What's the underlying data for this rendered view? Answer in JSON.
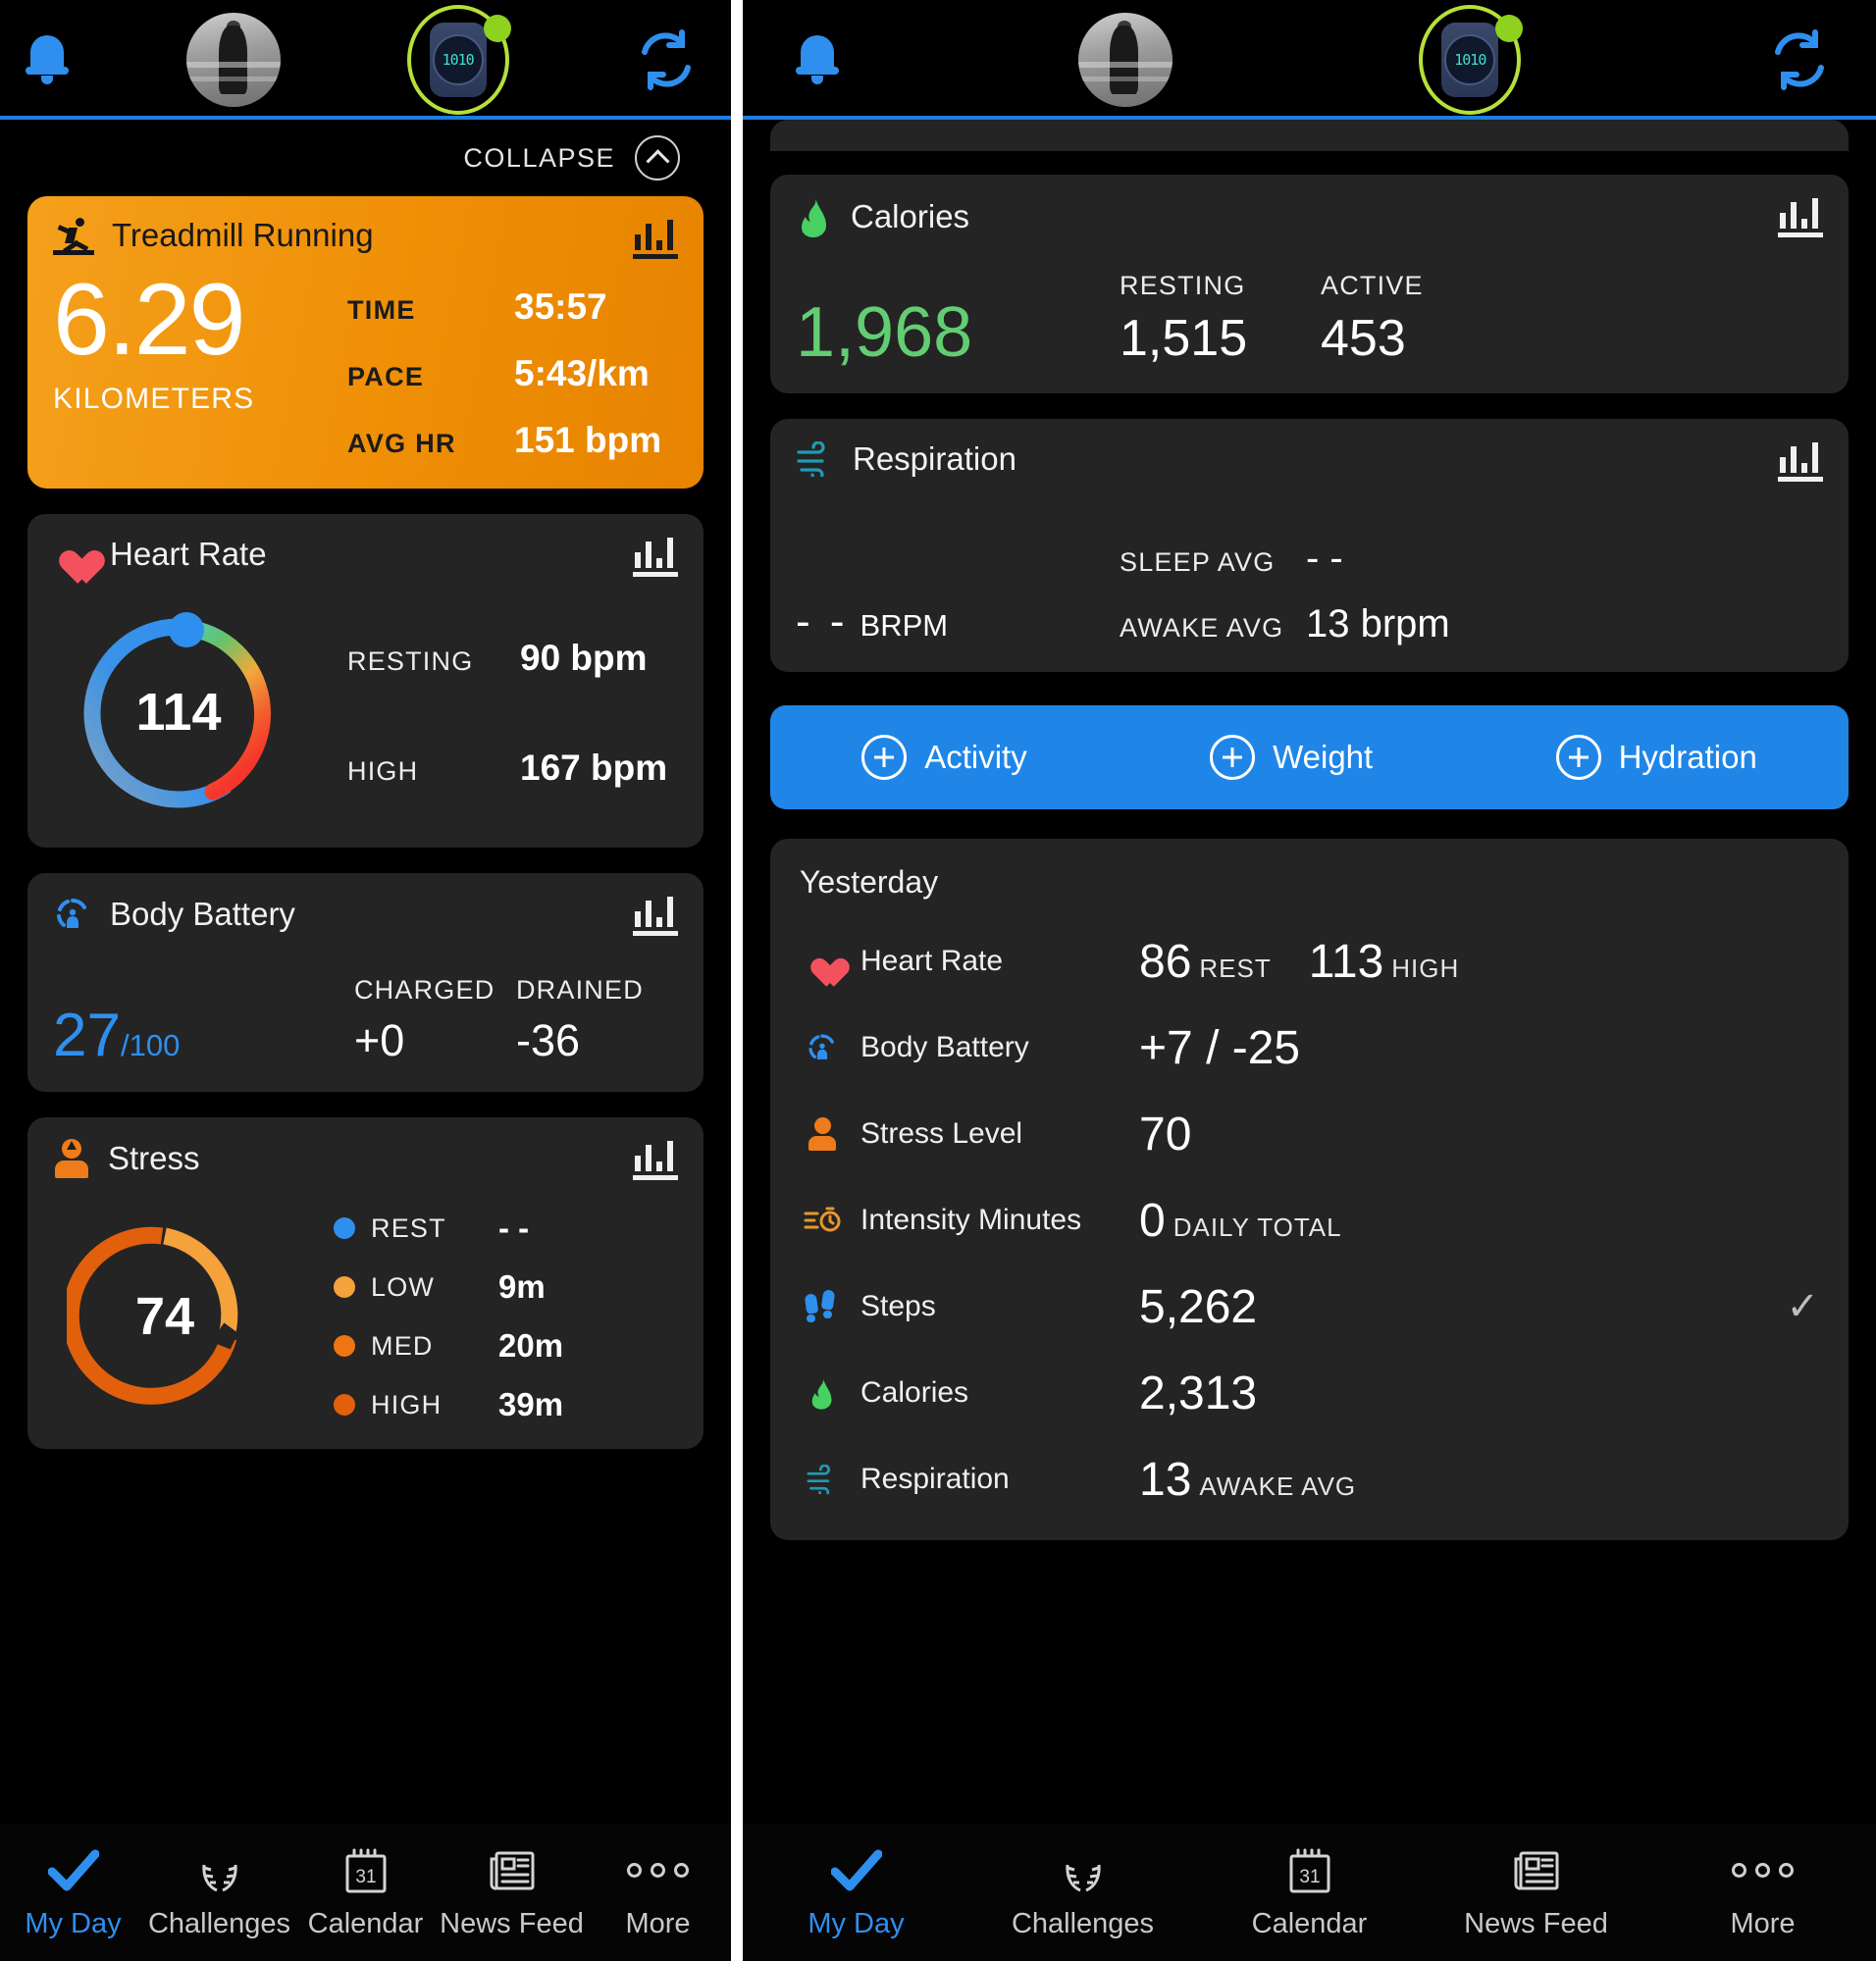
{
  "appbar": {
    "notifications_icon": "bell-icon",
    "avatar_icon": "user-avatar",
    "device_icon": "watch-device",
    "device_label": "1010",
    "sync_icon": "sync-icon"
  },
  "left": {
    "collapse": {
      "label": "COLLAPSE",
      "icon": "chevron-up-icon"
    },
    "activity": {
      "icon": "treadmill-running-icon",
      "title": "Treadmill Running",
      "chart_icon": "bar-chart-icon",
      "value": "6.29",
      "unit": "KILOMETERS",
      "stats": [
        {
          "label": "TIME",
          "value": "35:57"
        },
        {
          "label": "PACE",
          "value": "5:43/km"
        },
        {
          "label": "AVG HR",
          "value": "151 bpm"
        }
      ]
    },
    "heart_rate": {
      "icon": "heart-icon",
      "title": "Heart Rate",
      "chart_icon": "bar-chart-icon",
      "gauge_value": "114",
      "stats": [
        {
          "label": "RESTING",
          "value": "90 bpm"
        },
        {
          "label": "HIGH",
          "value": "167 bpm"
        }
      ]
    },
    "body_battery": {
      "icon": "body-battery-icon",
      "title": "Body Battery",
      "chart_icon": "bar-chart-icon",
      "value": "27",
      "denominator": "/100",
      "stats": [
        {
          "label": "CHARGED",
          "value": "+0"
        },
        {
          "label": "DRAINED",
          "value": "-36"
        }
      ]
    },
    "stress": {
      "icon": "stress-icon",
      "title": "Stress",
      "chart_icon": "bar-chart-icon",
      "gauge_value": "74",
      "legend": [
        {
          "label": "REST",
          "value": "- -",
          "color": "#2f8fef"
        },
        {
          "label": "LOW",
          "value": "9m",
          "color": "#f5a23c"
        },
        {
          "label": "MED",
          "value": "20m",
          "color": "#ee7512"
        },
        {
          "label": "HIGH",
          "value": "39m",
          "color": "#e2600b"
        }
      ]
    }
  },
  "right": {
    "calories": {
      "icon": "flame-icon",
      "title": "Calories",
      "chart_icon": "bar-chart-icon",
      "value": "1,968",
      "stats": [
        {
          "label": "RESTING",
          "value": "1,515"
        },
        {
          "label": "ACTIVE",
          "value": "453"
        }
      ]
    },
    "respiration": {
      "icon": "wind-icon",
      "title": "Respiration",
      "chart_icon": "bar-chart-icon",
      "value": "- -",
      "unit": "BRPM",
      "stats": [
        {
          "label": "SLEEP AVG",
          "value": "- -"
        },
        {
          "label": "AWAKE AVG",
          "value": "13 brpm"
        }
      ]
    },
    "add_bar": [
      {
        "icon": "plus-circle-icon",
        "label": "Activity"
      },
      {
        "icon": "plus-circle-icon",
        "label": "Weight"
      },
      {
        "icon": "plus-circle-icon",
        "label": "Hydration"
      }
    ],
    "yesterday": {
      "title": "Yesterday",
      "rows": [
        {
          "icon": "heart-icon",
          "label": "Heart Rate",
          "value": "86",
          "suffix": "REST",
          "value2": "113",
          "suffix2": "HIGH",
          "check": ""
        },
        {
          "icon": "body-battery-icon",
          "label": "Body Battery",
          "value": "+7 / -25",
          "suffix": "",
          "value2": "",
          "suffix2": "",
          "check": ""
        },
        {
          "icon": "stress-icon",
          "label": "Stress Level",
          "value": "70",
          "suffix": "",
          "value2": "",
          "suffix2": "",
          "check": ""
        },
        {
          "icon": "intensity-minutes-icon",
          "label": "Intensity Minutes",
          "value": "0",
          "suffix": "DAILY TOTAL",
          "value2": "",
          "suffix2": "",
          "check": ""
        },
        {
          "icon": "steps-icon",
          "label": "Steps",
          "value": "5,262",
          "suffix": "",
          "value2": "",
          "suffix2": "",
          "check": "✓"
        },
        {
          "icon": "flame-icon",
          "label": "Calories",
          "value": "2,313",
          "suffix": "",
          "value2": "",
          "suffix2": "",
          "check": ""
        },
        {
          "icon": "wind-icon",
          "label": "Respiration",
          "value": "13",
          "suffix": "AWAKE AVG",
          "value2": "",
          "suffix2": "",
          "check": ""
        }
      ]
    }
  },
  "nav": [
    {
      "icon": "check-icon",
      "label": "My Day",
      "active": true
    },
    {
      "icon": "laurel-icon",
      "label": "Challenges",
      "active": false
    },
    {
      "icon": "calendar-icon",
      "label": "Calendar",
      "active": false
    },
    {
      "icon": "newsfeed-icon",
      "label": "News Feed",
      "active": false
    },
    {
      "icon": "more-dots-icon",
      "label": "More",
      "active": false
    }
  ],
  "colors": {
    "accent_blue": "#2f8fef",
    "activity_orange": "#ef8f06",
    "calories_green": "#62cd72",
    "heart_red": "#f4515f",
    "respiration_teal": "#1f9bb5",
    "add_bar_blue": "#1f86e8",
    "card_bg": "#242424",
    "page_bg": "#000000"
  },
  "chart_data": [
    {
      "type": "pie",
      "title": "Heart Rate gauge",
      "value": 114,
      "min": 90,
      "max": 167,
      "fraction": 0.62,
      "labels": [
        "114"
      ],
      "legend_position": "right"
    },
    {
      "type": "pie",
      "title": "Stress gauge",
      "value": 74,
      "categories": [
        "REST",
        "LOW",
        "MED",
        "HIGH"
      ],
      "values": [
        0,
        9,
        20,
        39
      ],
      "unit": "minutes",
      "colors": [
        "#2f8fef",
        "#f5a23c",
        "#ee7512",
        "#e2600b"
      ],
      "legend_position": "right"
    }
  ]
}
